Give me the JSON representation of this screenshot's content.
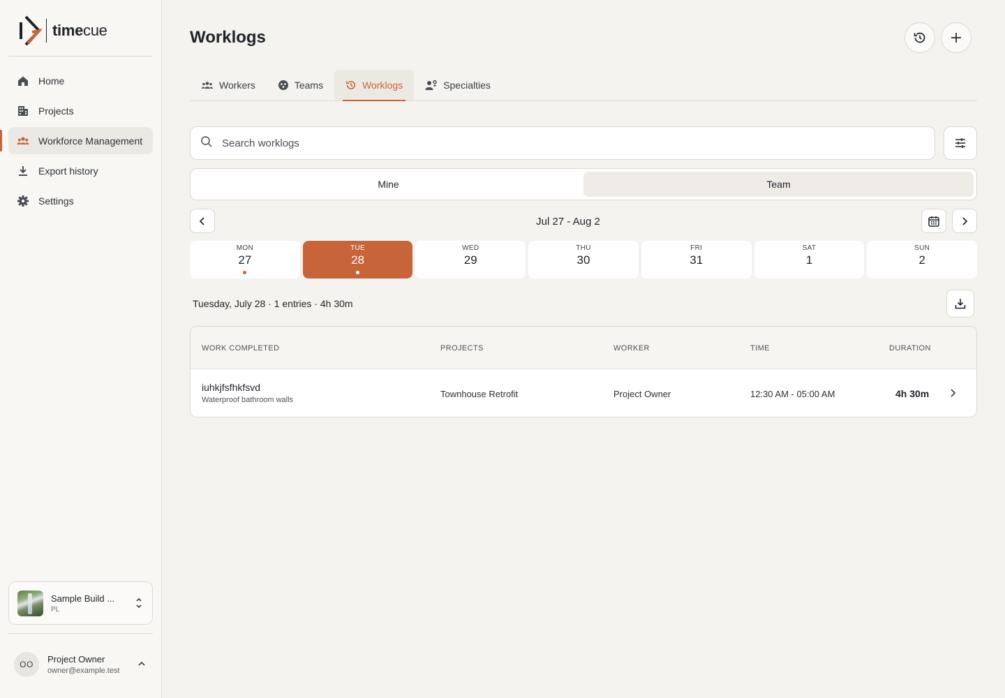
{
  "brand": {
    "name_bold": "time",
    "name_light": "cue",
    "accent": "#c8643a"
  },
  "sidebar": {
    "items": [
      {
        "label": "Home",
        "icon": "home-icon"
      },
      {
        "label": "Projects",
        "icon": "building-icon"
      },
      {
        "label": "Workforce Management",
        "icon": "people-icon"
      },
      {
        "label": "Export history",
        "icon": "download-icon"
      },
      {
        "label": "Settings",
        "icon": "gear-icon"
      }
    ],
    "active_index": 2,
    "org": {
      "name": "Sample Build ...",
      "sub": "PL"
    },
    "user": {
      "initials": "OO",
      "name": "Project Owner",
      "email": "owner@example.test"
    }
  },
  "header": {
    "title": "Worklogs"
  },
  "tabs": [
    {
      "label": "Workers",
      "icon": "workers-icon"
    },
    {
      "label": "Teams",
      "icon": "teams-icon"
    },
    {
      "label": "Worklogs",
      "icon": "history-icon"
    },
    {
      "label": "Specialties",
      "icon": "specialties-icon"
    }
  ],
  "search": {
    "placeholder": "Search worklogs",
    "value": ""
  },
  "scope_toggle": {
    "options": [
      "Mine",
      "Team"
    ],
    "selected": "Team"
  },
  "week": {
    "range_label": "Jul 27 - Aug 2",
    "days": [
      {
        "dow": "MON",
        "num": "27",
        "has_entries": true
      },
      {
        "dow": "TUE",
        "num": "28",
        "has_entries": true,
        "selected": true
      },
      {
        "dow": "WED",
        "num": "29"
      },
      {
        "dow": "THU",
        "num": "30"
      },
      {
        "dow": "FRI",
        "num": "31"
      },
      {
        "dow": "SAT",
        "num": "1"
      },
      {
        "dow": "SUN",
        "num": "2"
      }
    ]
  },
  "summary": "Tuesday, July 28 · 1 entries · 4h 30m",
  "table": {
    "headers": {
      "work": "WORK COMPLETED",
      "projects": "PROJECTS",
      "worker": "WORKER",
      "time": "TIME",
      "duration": "DURATION"
    },
    "rows": [
      {
        "title": "iuhkjfsfhkfsvd",
        "subtitle": "Waterproof bathroom walls",
        "project": "Townhouse Retrofit",
        "worker": "Project Owner",
        "time": "12:30 AM - 05:00 AM",
        "duration": "4h 30m"
      }
    ]
  }
}
